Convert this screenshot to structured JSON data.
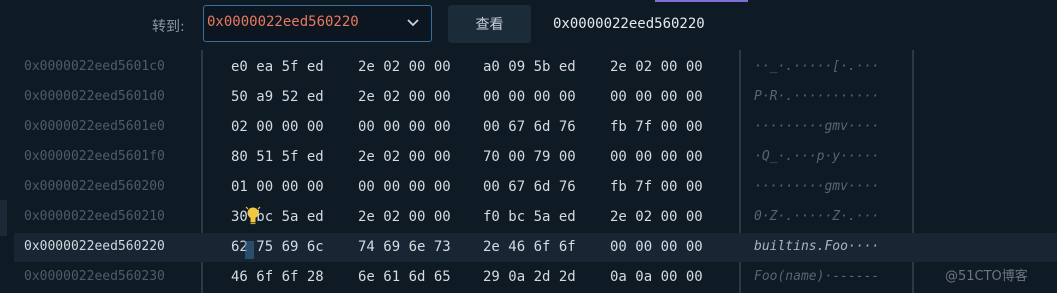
{
  "toolbar": {
    "goto_label": "转到:",
    "address_input": "0x0000022eed560220",
    "view_button": "查看",
    "current_address": "0x0000022eed560220"
  },
  "rows": [
    {
      "address": "0x0000022eed5601c0",
      "g1": "e0 ea 5f ed",
      "g2": "2e 02 00 00",
      "g3": "a0 09 5b ed",
      "g4": "2e 02 00 00",
      "ascii": "··_·.·····[·.···"
    },
    {
      "address": "0x0000022eed5601d0",
      "g1": "50 a9 52 ed",
      "g2": "2e 02 00 00",
      "g3": "00 00 00 00",
      "g4": "00 00 00 00",
      "ascii": "P·R·.···········"
    },
    {
      "address": "0x0000022eed5601e0",
      "g1": "02 00 00 00",
      "g2": "00 00 00 00",
      "g3": "00 67 6d 76",
      "g4": "fb 7f 00 00",
      "ascii": "·········gmv····"
    },
    {
      "address": "0x0000022eed5601f0",
      "g1": "80 51 5f ed",
      "g2": "2e 02 00 00",
      "g3": "70 00 79 00",
      "g4": "00 00 00 00",
      "ascii": "·Q_·.···p·y·····"
    },
    {
      "address": "0x0000022eed560200",
      "g1": "01 00 00 00",
      "g2": "00 00 00 00",
      "g3": "00 67 6d 76",
      "g4": "fb 7f 00 00",
      "ascii": "·········gmv····"
    },
    {
      "address": "0x0000022eed560210",
      "g1": "30 bc 5a ed",
      "g2": "2e 02 00 00",
      "g3": "f0 bc 5a ed",
      "g4": "2e 02 00 00",
      "ascii": "0·Z·.·····Z·.···"
    },
    {
      "address": "0x0000022eed560220",
      "g1": "62 75 69 6c",
      "g2": "74 69 6e 73",
      "g3": "2e 46 6f 6f",
      "g4": "00 00 00 00",
      "ascii": "builtins.Foo····"
    },
    {
      "address": "0x0000022eed560230",
      "g1": "46 6f 6f 28",
      "g2": "6e 61 6d 65",
      "g3": "29 0a 2d 2d",
      "g4": "0a 0a 00 00",
      "ascii": "Foo(name)·------"
    }
  ],
  "watermark": "@51CTO博客"
}
